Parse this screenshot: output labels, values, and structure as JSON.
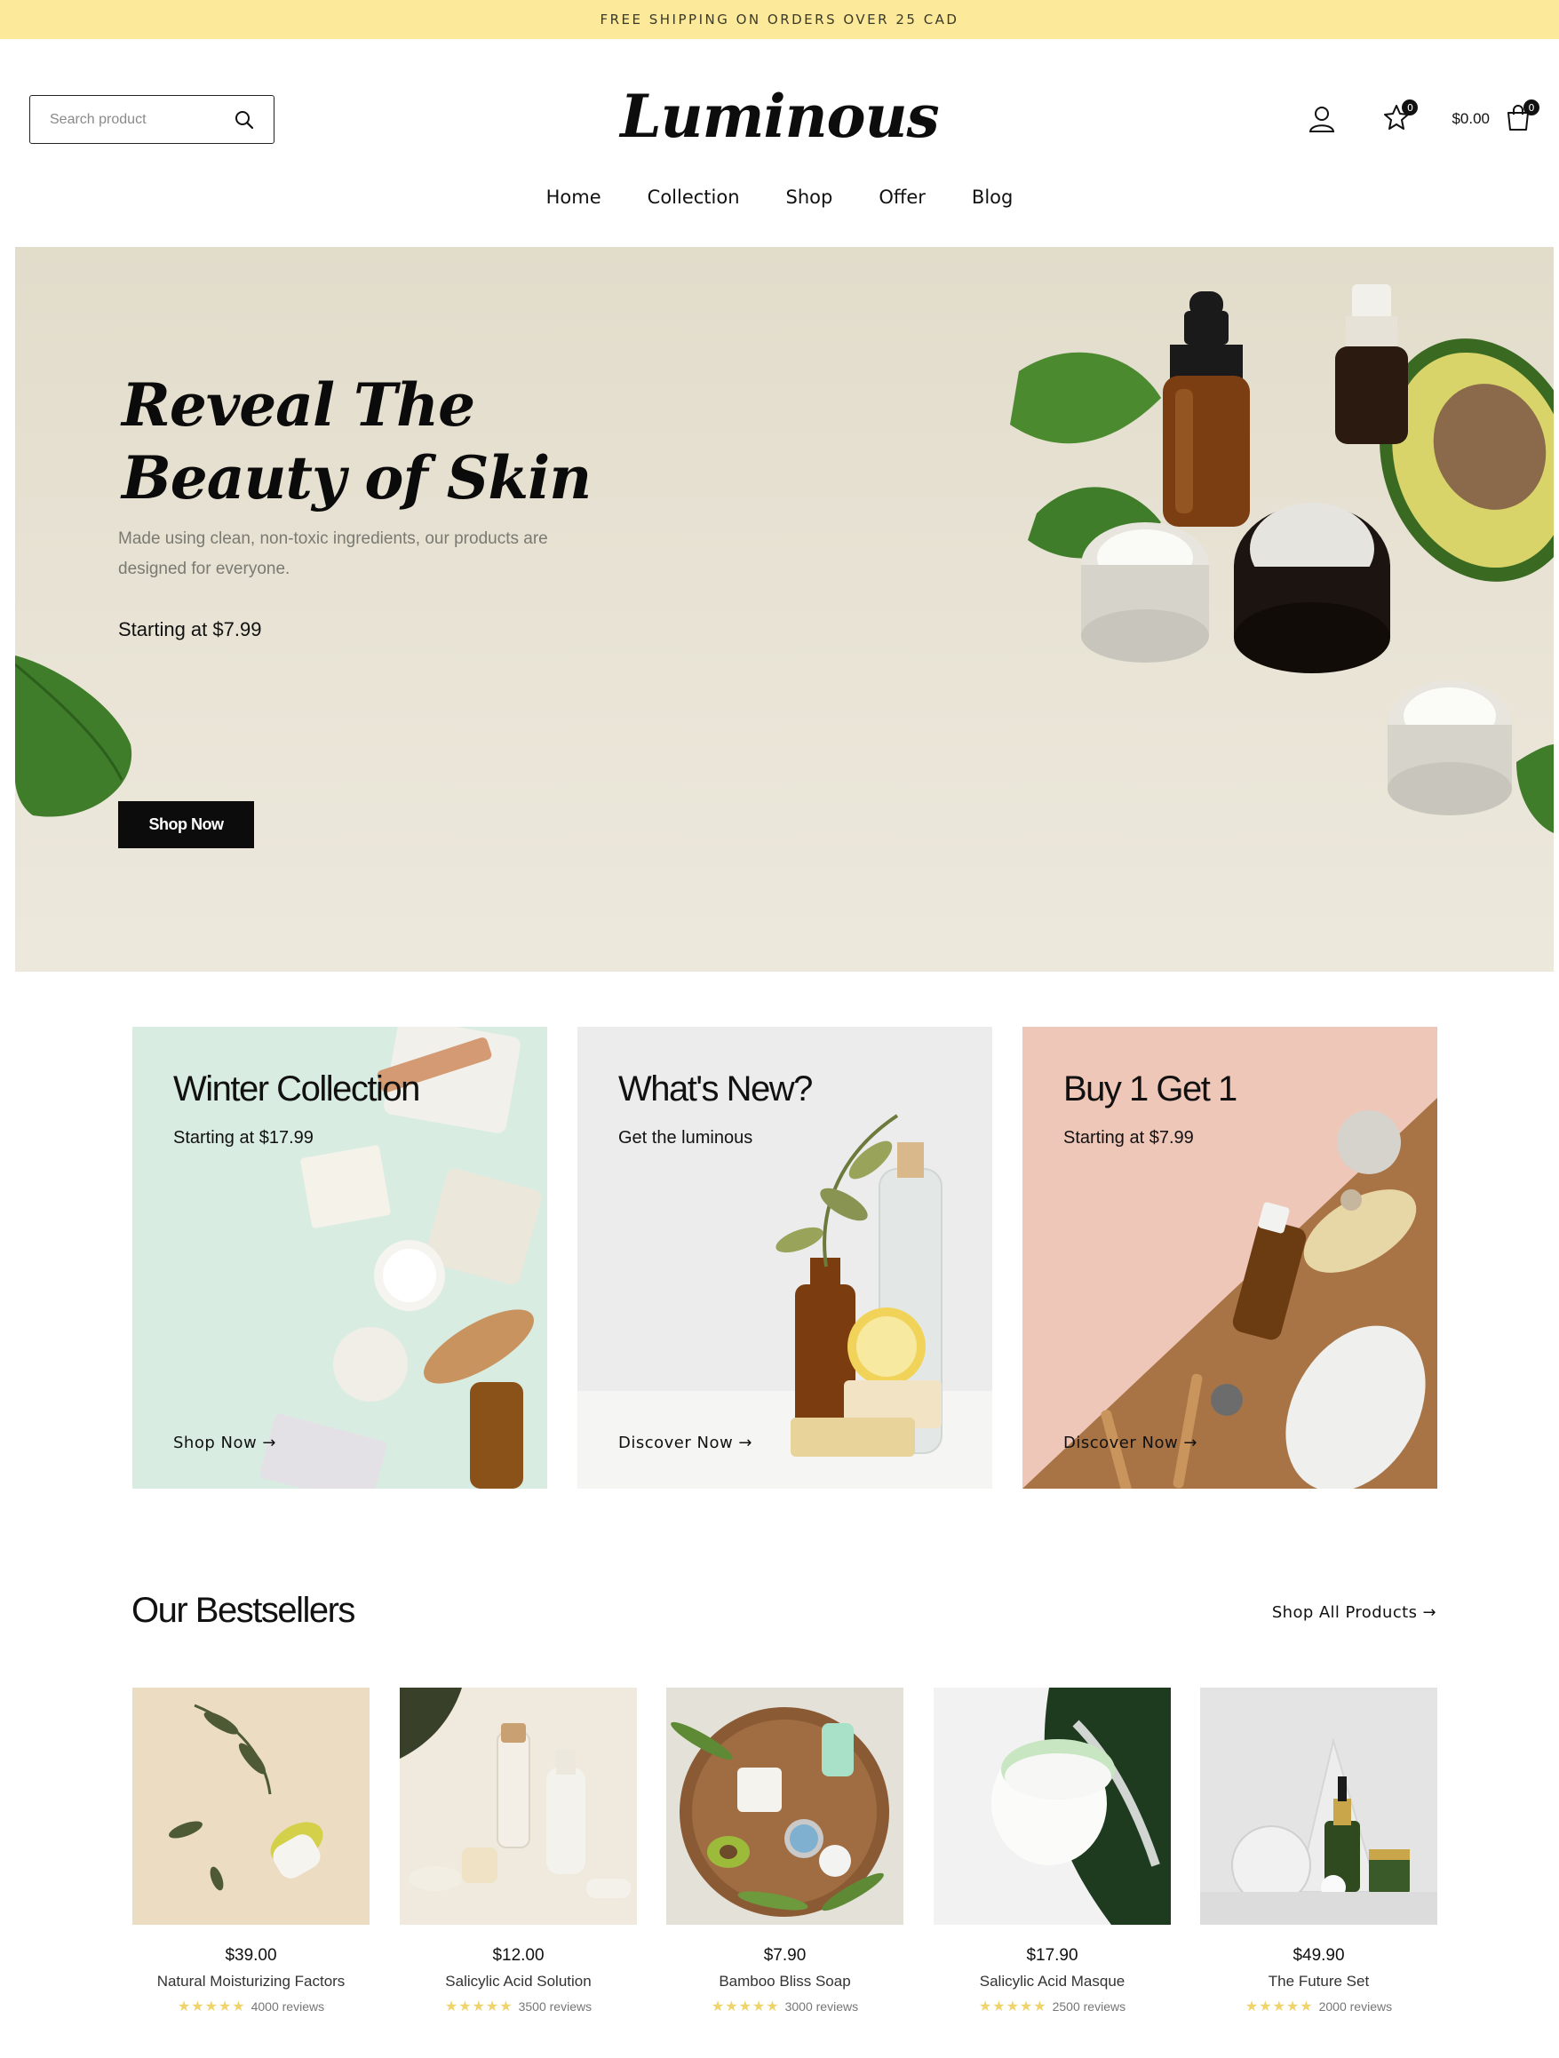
{
  "announcement": "FREE SHIPPING ON ORDERS OVER 25 CAD",
  "search": {
    "placeholder": "Search product"
  },
  "brand": "Luminous",
  "header": {
    "wishlist_count": "0",
    "cart_total": "$0.00",
    "cart_count": "0"
  },
  "nav": [
    "Home",
    "Collection",
    "Shop",
    "Offer",
    "Blog"
  ],
  "hero": {
    "title": "Reveal The\nBeauty of Skin",
    "subtitle": "Made using clean, non-toxic ingredients, our products are designed for everyone.",
    "price": "Starting at $7.99",
    "cta": "Shop Now"
  },
  "promos": [
    {
      "title": "Winter Collection",
      "subtitle": "Starting at $17.99",
      "link": "Shop Now →"
    },
    {
      "title": "What's New?",
      "subtitle": "Get the luminous",
      "link": "Discover Now →"
    },
    {
      "title": "Buy 1 Get 1",
      "subtitle": "Starting at $7.99",
      "link": "Discover Now →"
    }
  ],
  "bestsellers": {
    "title": "Our Bestsellers",
    "shop_all": "Shop All Products →",
    "products": [
      {
        "price": "$39.00",
        "name": "Natural Moisturizing Factors",
        "stars": "★★★★★",
        "reviews": "4000 reviews"
      },
      {
        "price": "$12.00",
        "name": "Salicylic Acid Solution",
        "stars": "★★★★★",
        "reviews": "3500 reviews"
      },
      {
        "price": "$7.90",
        "name": "Bamboo Bliss Soap",
        "stars": "★★★★★",
        "reviews": "3000 reviews"
      },
      {
        "price": "$17.90",
        "name": "Salicylic Acid Masque",
        "stars": "★★★★★",
        "reviews": "2500 reviews"
      },
      {
        "price": "$49.90",
        "name": "The Future Set",
        "stars": "★★★★★",
        "reviews": "2000 reviews"
      }
    ]
  },
  "colors": {
    "announcement_bg": "#fde99a",
    "hero_bg": "#e6e1d2",
    "button_bg": "#0c0c0c",
    "star": "#f0d36a"
  }
}
